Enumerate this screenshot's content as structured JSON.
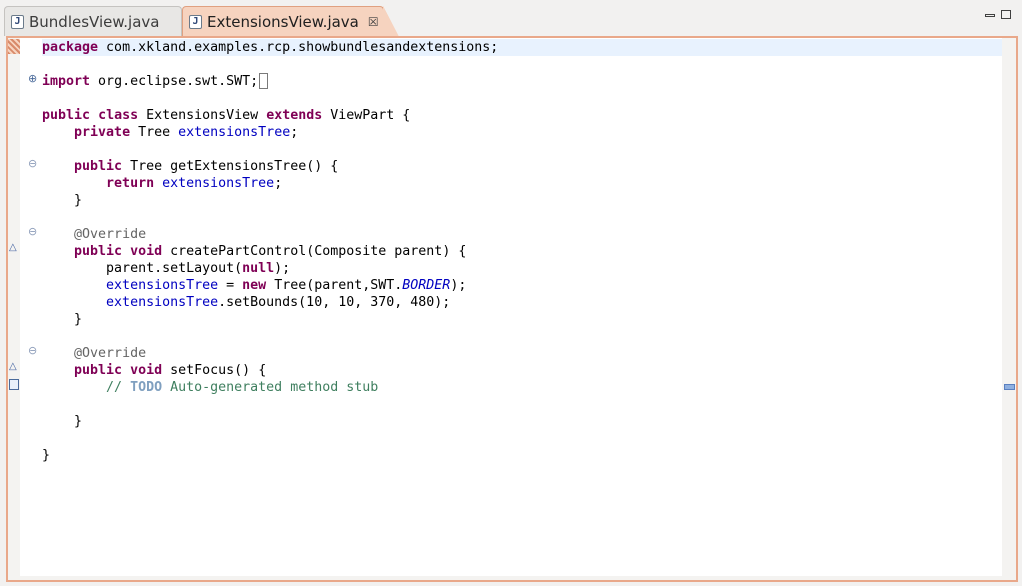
{
  "tabs": [
    {
      "label": "BundlesView.java",
      "icon": "java-file-icon",
      "active": false
    },
    {
      "label": "ExtensionsView.java",
      "icon": "java-file-icon",
      "active": true
    }
  ],
  "close_symbol": "☒",
  "file_icon_letter": "J",
  "code": {
    "line1": {
      "kw": "package",
      "rest": " com.xkland.examples.rcp.showbundlesandextensions;"
    },
    "line2": {
      "kw": "import",
      "rest": " org.eclipse.swt.SWT;"
    },
    "line3": {
      "kw1": "public",
      "kw2": "class",
      "mid": " ExtensionsView ",
      "kw3": "extends",
      "rest": " ViewPart {"
    },
    "line4": {
      "kw": "private",
      "mid": " Tree ",
      "fld": "extensionsTree",
      "rest": ";"
    },
    "line5": {
      "kw": "public",
      "rest": " Tree getExtensionsTree() {"
    },
    "line6": {
      "kw": "return",
      "fld": "extensionsTree",
      "rest": ";"
    },
    "line7": {
      "text": "}"
    },
    "line8": {
      "an": "@Override"
    },
    "line9": {
      "kw1": "public",
      "kw2": "void",
      "rest": " createPartControl(Composite parent) {"
    },
    "line10": {
      "pre": "parent.setLayout(",
      "kw": "null",
      "post": ");"
    },
    "line11": {
      "fld": "extensionsTree",
      "mid": " = ",
      "kw": "new",
      "rest": " Tree(parent,SWT.",
      "st": "BORDER",
      "post": ");"
    },
    "line12": {
      "fld": "extensionsTree",
      "rest": ".setBounds(10, 10, 370, 480);"
    },
    "line13": {
      "text": "}"
    },
    "line14": {
      "an": "@Override"
    },
    "line15": {
      "kw1": "public",
      "kw2": "void",
      "rest": " setFocus() {"
    },
    "line16": {
      "slashes": "// ",
      "todo": "TODO",
      "rest": " Auto-generated method stub"
    },
    "line17": {
      "text": "}"
    },
    "line18": {
      "text": "}"
    }
  },
  "colors": {
    "keyword": "#7f0055",
    "field": "#0000c0",
    "annotation": "#646464",
    "comment": "#3f7f5f",
    "todo": "#7f9fbf",
    "active_tab": "#f6d3bf",
    "editor_border": "#e9a88a"
  }
}
